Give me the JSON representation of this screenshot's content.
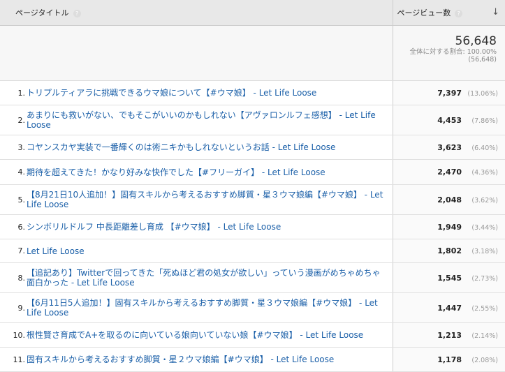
{
  "header": {
    "page_title_label": "ページタイトル",
    "pageviews_label": "ページビュー数",
    "help_icon": "?",
    "sort_icon": "↓"
  },
  "summary": {
    "total": "56,648",
    "share_label": "全体に対する割合: 100.00%",
    "share_total": "(56,648)"
  },
  "rows": [
    {
      "rank": "1.",
      "title": "トリプルティアラに挑戦できるウマ娘について【#ウマ娘】 - Let Life Loose",
      "views": "7,397",
      "pct": "(13.06%)"
    },
    {
      "rank": "2.",
      "title": "あまりにも救いがない、でもそこがいいのかもしれない【アヴァロンルフェ感想】 - Let Life Loose",
      "views": "4,453",
      "pct": "(7.86%)"
    },
    {
      "rank": "3.",
      "title": "コヤンスカヤ実装で一番輝くのは術ニキかもしれないというお話 - Let Life Loose",
      "views": "3,623",
      "pct": "(6.40%)"
    },
    {
      "rank": "4.",
      "title": "期待を超えてきた！かなり好みな快作でした【#フリーガイ】 - Let Life Loose",
      "views": "2,470",
      "pct": "(4.36%)"
    },
    {
      "rank": "5.",
      "title": "【8月21日10人追加！】固有スキルから考えるおすすめ脚質・星３ウマ娘編【#ウマ娘】 - Let Life Loose",
      "views": "2,048",
      "pct": "(3.62%)"
    },
    {
      "rank": "6.",
      "title": "シンボリルドルフ 中長距離差し育成 【#ウマ娘】 - Let Life Loose",
      "views": "1,949",
      "pct": "(3.44%)"
    },
    {
      "rank": "7.",
      "title": "Let Life Loose",
      "views": "1,802",
      "pct": "(3.18%)"
    },
    {
      "rank": "8.",
      "title": "【追記あり】Twitterで回ってきた「死ぬほど君の処女が欲しい」っていう漫画がめちゃめちゃ面白かった - Let Life Loose",
      "views": "1,545",
      "pct": "(2.73%)"
    },
    {
      "rank": "9.",
      "title": "【6月11日5人追加！】固有スキルから考えるおすすめ脚質・星３ウマ娘編【#ウマ娘】 - Let Life Loose",
      "views": "1,447",
      "pct": "(2.55%)"
    },
    {
      "rank": "10.",
      "title": "根性賢さ育成でA+を取るのに向いている娘向いていない娘【#ウマ娘】 - Let Life Loose",
      "views": "1,213",
      "pct": "(2.14%)"
    },
    {
      "rank": "11.",
      "title": "固有スキルから考えるおすすめ脚質・星２ウマ娘編【#ウマ娘】 - Let Life Loose",
      "views": "1,178",
      "pct": "(2.08%)"
    }
  ]
}
